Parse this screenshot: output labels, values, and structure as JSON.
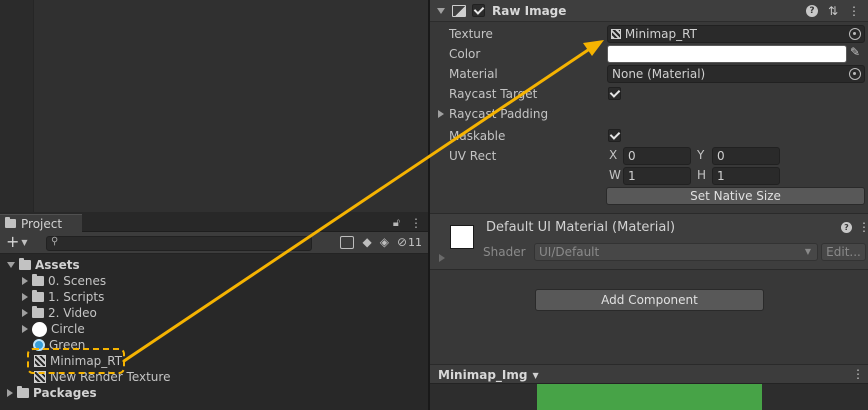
{
  "project": {
    "tab_label": "Project",
    "search_placeholder": "",
    "hidden_count": "11",
    "tree": {
      "assets": "Assets",
      "scenes": "0. Scenes",
      "scripts": "1. Scripts",
      "video": "2. Video",
      "circle": "Circle",
      "green": "Green",
      "minimap_rt": "Minimap_RT",
      "new_rt": "New Render Texture",
      "packages": "Packages"
    }
  },
  "inspector": {
    "component_title": "Raw Image",
    "texture_label": "Texture",
    "texture_value": "Minimap_RT",
    "color_label": "Color",
    "color_value": "#ffffff",
    "material_label": "Material",
    "material_value": "None (Material)",
    "raycast_target_label": "Raycast Target",
    "raycast_target_checked": true,
    "raycast_padding_label": "Raycast Padding",
    "maskable_label": "Maskable",
    "maskable_checked": true,
    "uvrect_label": "UV Rect",
    "uv": {
      "x_label": "X",
      "x": "0",
      "y_label": "Y",
      "y": "0",
      "w_label": "W",
      "w": "1",
      "h_label": "H",
      "h": "1"
    },
    "set_native_size": "Set Native Size",
    "material_section": {
      "title": "Default UI Material (Material)",
      "shader_label": "Shader",
      "shader_value": "UI/Default",
      "edit_label": "Edit..."
    },
    "add_component": "Add Component",
    "preview_title": "Minimap_Img",
    "accent_arrow_color": "#f5b301"
  }
}
